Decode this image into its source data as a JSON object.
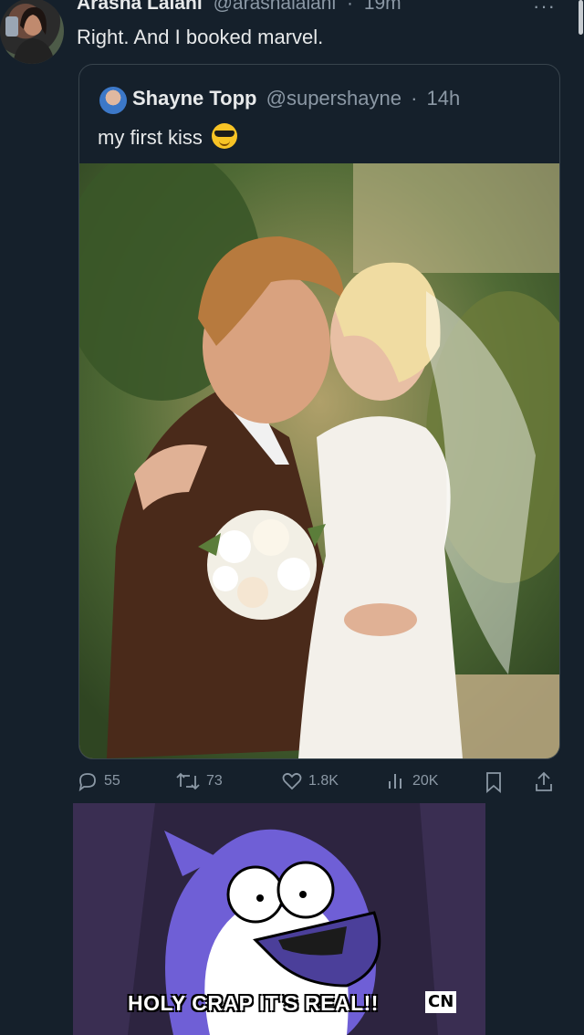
{
  "tweet": {
    "author_name": "Arasha Lalani",
    "author_handle": "@arashalalani",
    "time": "19m",
    "text": "Right. And I booked marvel."
  },
  "quoted": {
    "author_name": "Shayne Topp",
    "author_handle": "@supershayne",
    "time": "14h",
    "text": "my first kiss",
    "emoji": "sunglasses-face-emoji"
  },
  "actions": {
    "replies": "55",
    "retweets": "73",
    "likes": "1.8K",
    "views": "20K"
  },
  "meme": {
    "caption": "HOLY CRAP IT'S REAL!!",
    "logo": "CN"
  },
  "colors": {
    "background": "#15202b",
    "secondary_text": "#8b98a5",
    "border": "#38444d"
  }
}
